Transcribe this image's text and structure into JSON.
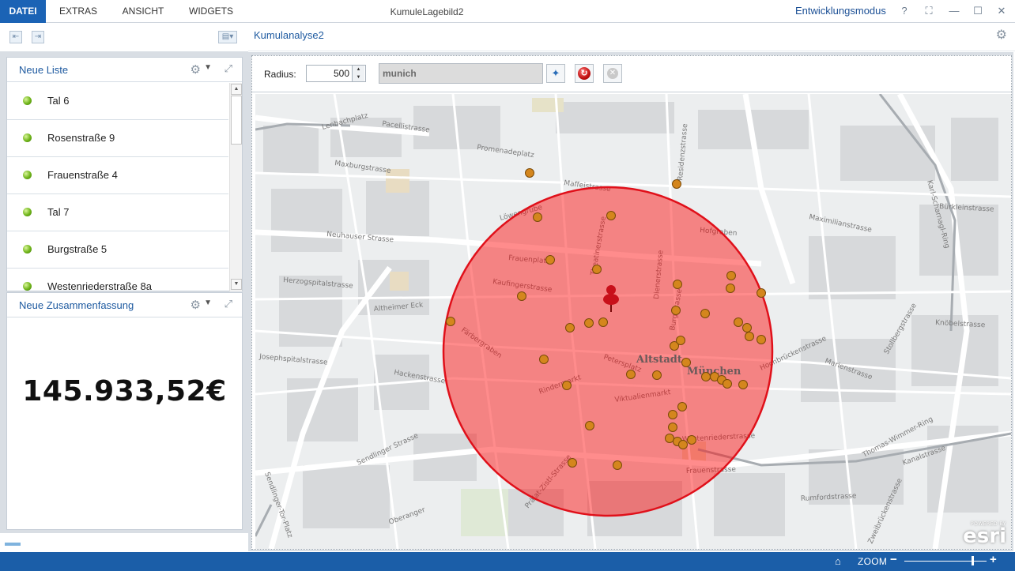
{
  "menu": {
    "tabs": [
      {
        "label": "DATEI",
        "active": true
      },
      {
        "label": "EXTRAS",
        "active": false
      },
      {
        "label": "ANSICHT",
        "active": false
      },
      {
        "label": "WIDGETS",
        "active": false
      }
    ],
    "app_title": "KumuleLagebild2",
    "dev_mode": "Entwicklungsmodus",
    "controls": {
      "help": "?",
      "restore": "⛶",
      "minimize": "—",
      "maximize": "☐",
      "close": "✕"
    }
  },
  "list_panel": {
    "title": "Neue Liste",
    "items": [
      {
        "label": "Tal 6"
      },
      {
        "label": "Rosenstraße 9"
      },
      {
        "label": "Frauenstraße 4"
      },
      {
        "label": "Tal 7"
      },
      {
        "label": "Burgstraße 5"
      },
      {
        "label": "Westenriederstraße 8a"
      }
    ]
  },
  "summary_panel": {
    "title": "Neue Zusammenfassung",
    "value": "145.933,52€"
  },
  "analysis": {
    "title": "Kumulanalyse2",
    "radius_label": "Radius:",
    "radius_value": "500",
    "location_value": "munich"
  },
  "map": {
    "circle_fill": "#ff0000",
    "circle_stroke": "#e0101a",
    "marker_color": "#d4861d",
    "pin_color": "#c8101a",
    "labels": {
      "altstadt": "Altstadt",
      "muenchen": "München",
      "lenbachplatz": "Lenbachplatz",
      "pacellistrasse": "Pacellistrasse",
      "maxburgstrasse": "Maxburgstrasse",
      "maffeistrasse": "Maffeistrasse",
      "loewengrube": "Löwengrube",
      "promenadeplatz": "Promenadeplatz",
      "neuhauser": "Neuhauser Strasse",
      "frauenplatz": "Frauenplatz",
      "kaufingerstrasse": "Kaufingerstrasse",
      "herzogspitalstrasse": "Herzogspitalstrasse",
      "altheimer": "Altheimer Eck",
      "josephspitalstrasse": "Josephspitalstrasse",
      "hackenstrasse": "Hackenstrasse",
      "sendlinger": "Sendlinger Strasse",
      "oberanger": "Oberanger",
      "sendlinger_tor": "Sendlinger-Tor-Platz",
      "theatinerstrasse": "Theatinerstrasse",
      "residenzstrasse": "Residenzstrasse",
      "hofgraben": "Hofgraben",
      "maximilianstrasse": "Maximilianstrasse",
      "burgstrasse": "Burgstrasse",
      "dienerstrasse": "Dienerstrasse",
      "frauenstrasse": "Frauenstrasse",
      "westenriederstrasse": "Westenriederstrasse",
      "thomas_wimmer": "Thomas-Wimmer-Ring",
      "karl_scharnagl": "Karl-Scharnagl-Ring",
      "buerkleinstrasse": "Bürkleinstrasse",
      "knoebelstrasse": "Knöbelstrasse",
      "hochbrueckenstrasse": "Hochbrückenstrasse",
      "marienstrasse": "Marienstrasse",
      "rumfordstrasse": "Rumfordstrasse",
      "kanalstrasse": "Kanalstrasse",
      "viktualienmarkt": "Viktualienmarkt",
      "rindermarkt": "Rindermarkt",
      "petersplatz": "Petersplatz",
      "stollbergstrasse": "Stollbergstrasse",
      "zweibrueckenstrasse": "Zweibrückenstrasse",
      "praelat_zistl": "Prälat-Zistl-Strasse",
      "fuerstenfelder": "Färbergraben"
    }
  },
  "esri": {
    "powered": "POWERED BY",
    "name": "esri"
  },
  "statusbar": {
    "zoom_label": "ZOOM",
    "zoom_minus": "−",
    "zoom_plus": "+",
    "home": "⌂",
    "zoom_level": 0.82
  }
}
